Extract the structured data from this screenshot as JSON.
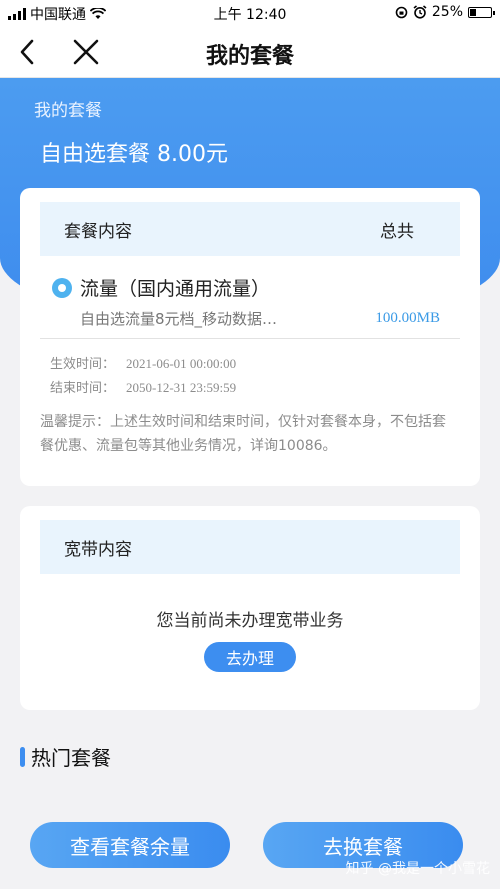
{
  "status_bar": {
    "carrier": "中国联通",
    "time": "上午 12:40",
    "battery": "25%",
    "battery_level": 0.25
  },
  "nav": {
    "title": "我的套餐"
  },
  "header": {
    "label": "我的套餐",
    "package": "自由选套餐 8.00元"
  },
  "plan_card": {
    "col_content": "套餐内容",
    "col_total": "总共",
    "item_title": "流量（国内通用流量）",
    "item_desc": "自由选流量8元档_移动数据…",
    "item_amount": "100.00MB",
    "effective_label": "生效时间：",
    "effective_value": "2021-06-01 00:00:00",
    "end_label": "结束时间：",
    "end_value": "2050-12-31 23:59:59",
    "tip": "温馨提示：上述生效时间和结束时间，仅针对套餐本身，不包括套餐优惠、流量包等其他业务情况，详询10086。"
  },
  "broadband_card": {
    "title": "宽带内容",
    "message": "您当前尚未办理宽带业务",
    "apply_button": "去办理"
  },
  "hot": {
    "title": "热门套餐"
  },
  "bottom": {
    "check_button": "查看套餐余量",
    "change_button": "去换套餐"
  },
  "watermark": "知乎 @我是一个小雪花",
  "colors": {
    "accent": "#3d8ef0",
    "header_blue": "#4c9cf0",
    "amount_blue": "#3a9ae6",
    "card_head_bg": "#e9f4fd"
  }
}
